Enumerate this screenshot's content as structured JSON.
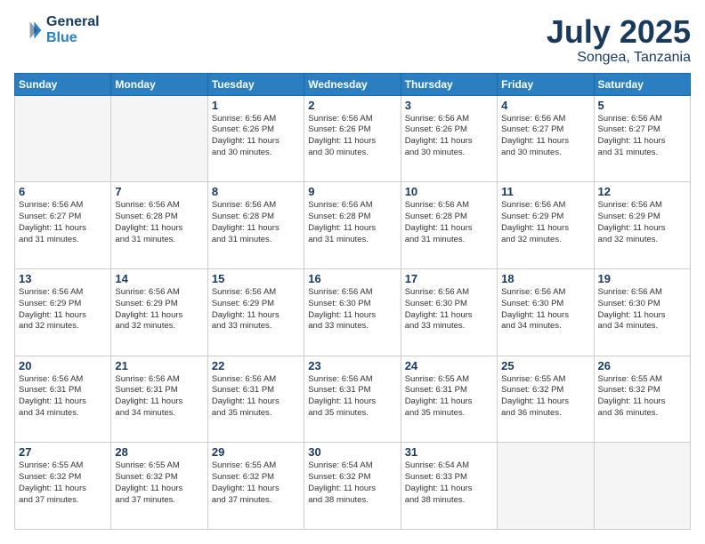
{
  "header": {
    "logo_line1": "General",
    "logo_line2": "Blue",
    "title": "July 2025",
    "subtitle": "Songea, Tanzania"
  },
  "days_of_week": [
    "Sunday",
    "Monday",
    "Tuesday",
    "Wednesday",
    "Thursday",
    "Friday",
    "Saturday"
  ],
  "weeks": [
    [
      {
        "day": "",
        "info": ""
      },
      {
        "day": "",
        "info": ""
      },
      {
        "day": "1",
        "info": "Sunrise: 6:56 AM\nSunset: 6:26 PM\nDaylight: 11 hours\nand 30 minutes."
      },
      {
        "day": "2",
        "info": "Sunrise: 6:56 AM\nSunset: 6:26 PM\nDaylight: 11 hours\nand 30 minutes."
      },
      {
        "day": "3",
        "info": "Sunrise: 6:56 AM\nSunset: 6:26 PM\nDaylight: 11 hours\nand 30 minutes."
      },
      {
        "day": "4",
        "info": "Sunrise: 6:56 AM\nSunset: 6:27 PM\nDaylight: 11 hours\nand 30 minutes."
      },
      {
        "day": "5",
        "info": "Sunrise: 6:56 AM\nSunset: 6:27 PM\nDaylight: 11 hours\nand 31 minutes."
      }
    ],
    [
      {
        "day": "6",
        "info": "Sunrise: 6:56 AM\nSunset: 6:27 PM\nDaylight: 11 hours\nand 31 minutes."
      },
      {
        "day": "7",
        "info": "Sunrise: 6:56 AM\nSunset: 6:28 PM\nDaylight: 11 hours\nand 31 minutes."
      },
      {
        "day": "8",
        "info": "Sunrise: 6:56 AM\nSunset: 6:28 PM\nDaylight: 11 hours\nand 31 minutes."
      },
      {
        "day": "9",
        "info": "Sunrise: 6:56 AM\nSunset: 6:28 PM\nDaylight: 11 hours\nand 31 minutes."
      },
      {
        "day": "10",
        "info": "Sunrise: 6:56 AM\nSunset: 6:28 PM\nDaylight: 11 hours\nand 31 minutes."
      },
      {
        "day": "11",
        "info": "Sunrise: 6:56 AM\nSunset: 6:29 PM\nDaylight: 11 hours\nand 32 minutes."
      },
      {
        "day": "12",
        "info": "Sunrise: 6:56 AM\nSunset: 6:29 PM\nDaylight: 11 hours\nand 32 minutes."
      }
    ],
    [
      {
        "day": "13",
        "info": "Sunrise: 6:56 AM\nSunset: 6:29 PM\nDaylight: 11 hours\nand 32 minutes."
      },
      {
        "day": "14",
        "info": "Sunrise: 6:56 AM\nSunset: 6:29 PM\nDaylight: 11 hours\nand 32 minutes."
      },
      {
        "day": "15",
        "info": "Sunrise: 6:56 AM\nSunset: 6:29 PM\nDaylight: 11 hours\nand 33 minutes."
      },
      {
        "day": "16",
        "info": "Sunrise: 6:56 AM\nSunset: 6:30 PM\nDaylight: 11 hours\nand 33 minutes."
      },
      {
        "day": "17",
        "info": "Sunrise: 6:56 AM\nSunset: 6:30 PM\nDaylight: 11 hours\nand 33 minutes."
      },
      {
        "day": "18",
        "info": "Sunrise: 6:56 AM\nSunset: 6:30 PM\nDaylight: 11 hours\nand 34 minutes."
      },
      {
        "day": "19",
        "info": "Sunrise: 6:56 AM\nSunset: 6:30 PM\nDaylight: 11 hours\nand 34 minutes."
      }
    ],
    [
      {
        "day": "20",
        "info": "Sunrise: 6:56 AM\nSunset: 6:31 PM\nDaylight: 11 hours\nand 34 minutes."
      },
      {
        "day": "21",
        "info": "Sunrise: 6:56 AM\nSunset: 6:31 PM\nDaylight: 11 hours\nand 34 minutes."
      },
      {
        "day": "22",
        "info": "Sunrise: 6:56 AM\nSunset: 6:31 PM\nDaylight: 11 hours\nand 35 minutes."
      },
      {
        "day": "23",
        "info": "Sunrise: 6:56 AM\nSunset: 6:31 PM\nDaylight: 11 hours\nand 35 minutes."
      },
      {
        "day": "24",
        "info": "Sunrise: 6:55 AM\nSunset: 6:31 PM\nDaylight: 11 hours\nand 35 minutes."
      },
      {
        "day": "25",
        "info": "Sunrise: 6:55 AM\nSunset: 6:32 PM\nDaylight: 11 hours\nand 36 minutes."
      },
      {
        "day": "26",
        "info": "Sunrise: 6:55 AM\nSunset: 6:32 PM\nDaylight: 11 hours\nand 36 minutes."
      }
    ],
    [
      {
        "day": "27",
        "info": "Sunrise: 6:55 AM\nSunset: 6:32 PM\nDaylight: 11 hours\nand 37 minutes."
      },
      {
        "day": "28",
        "info": "Sunrise: 6:55 AM\nSunset: 6:32 PM\nDaylight: 11 hours\nand 37 minutes."
      },
      {
        "day": "29",
        "info": "Sunrise: 6:55 AM\nSunset: 6:32 PM\nDaylight: 11 hours\nand 37 minutes."
      },
      {
        "day": "30",
        "info": "Sunrise: 6:54 AM\nSunset: 6:32 PM\nDaylight: 11 hours\nand 38 minutes."
      },
      {
        "day": "31",
        "info": "Sunrise: 6:54 AM\nSunset: 6:33 PM\nDaylight: 11 hours\nand 38 minutes."
      },
      {
        "day": "",
        "info": ""
      },
      {
        "day": "",
        "info": ""
      }
    ]
  ]
}
